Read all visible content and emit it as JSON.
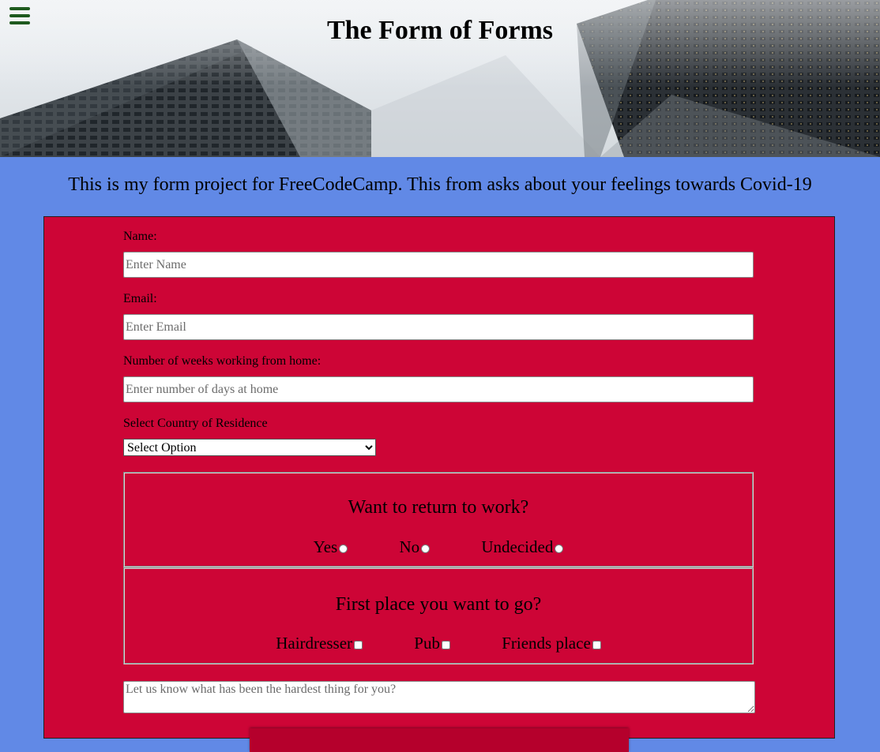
{
  "header": {
    "title": "The Form of Forms",
    "menu_icon": "hamburger-menu-icon"
  },
  "intro": "This is my form project for FreeCodeCamp. This from asks about your feelings towards Covid-19",
  "form": {
    "name": {
      "label": "Name:",
      "placeholder": "Enter Name"
    },
    "email": {
      "label": "Email:",
      "placeholder": "Enter Email"
    },
    "weeks": {
      "label": "Number of weeks working from home:",
      "placeholder": "Enter number of days at home"
    },
    "country": {
      "label": "Select Country of Residence",
      "selected": "Select Option"
    },
    "return_to_work": {
      "title": "Want to return to work?",
      "options": [
        "Yes",
        "No",
        "Undecided"
      ]
    },
    "first_place": {
      "title": "First place you want to go?",
      "options": [
        "Hairdresser",
        "Pub",
        "Friends place"
      ]
    },
    "comments": {
      "placeholder": "Let us know what has been the hardest thing for you?"
    }
  },
  "colors": {
    "page_bg": "#6189e6",
    "form_bg": "#cd0536",
    "menu_icon": "#1e5a1e"
  }
}
